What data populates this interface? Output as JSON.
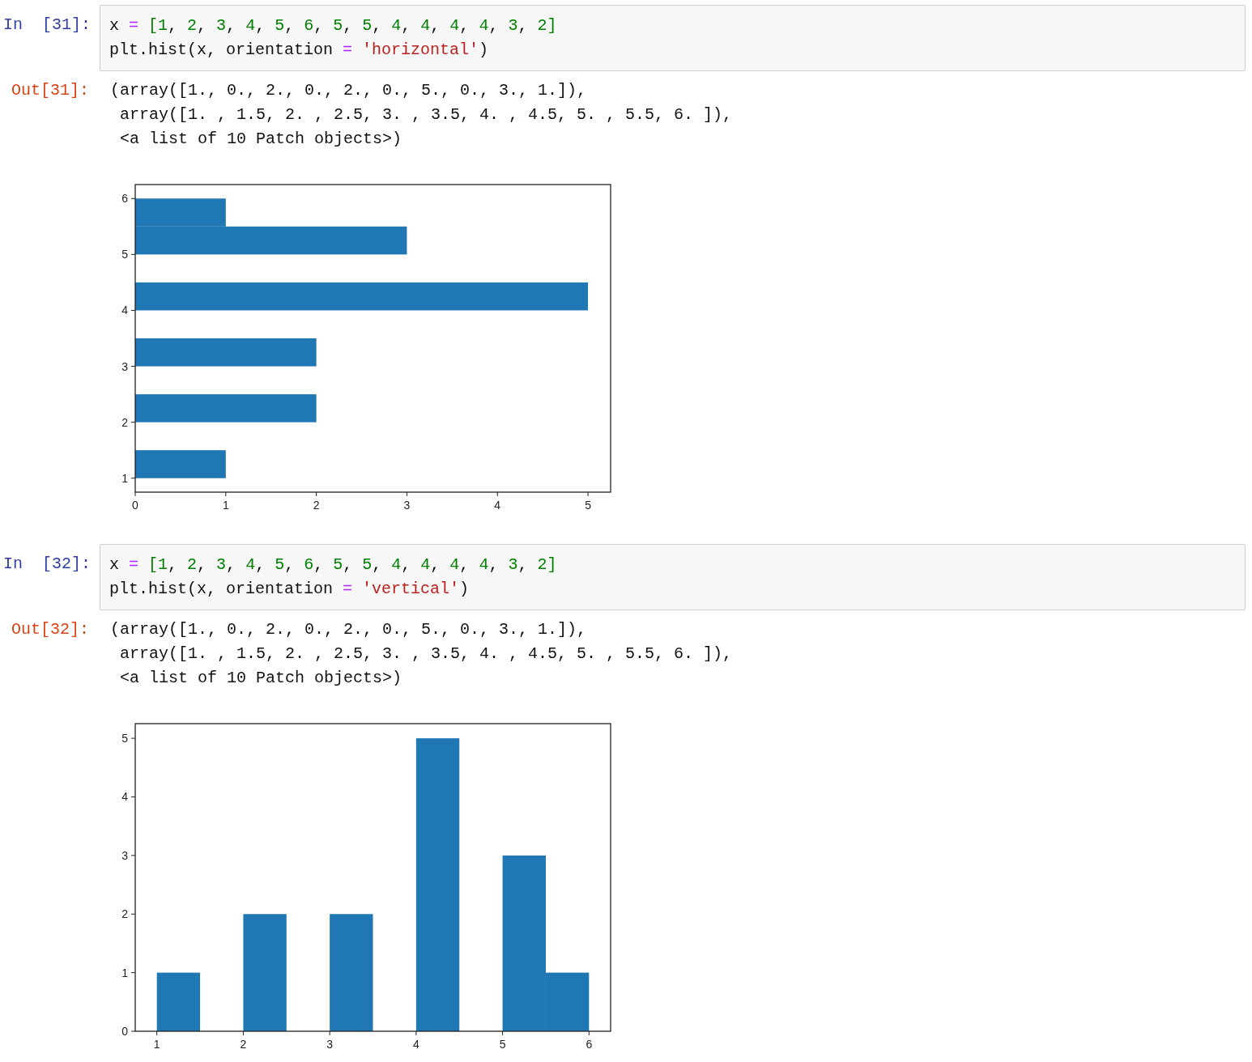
{
  "cells": [
    {
      "in_prompt": "In  [31]:",
      "code_lines": [
        [
          {
            "text": "x ",
            "kind": "plain"
          },
          {
            "text": "=",
            "kind": "op"
          },
          {
            "text": " [1",
            "kind": "num"
          },
          {
            "text": ", ",
            "kind": "plain"
          },
          {
            "text": "2",
            "kind": "num"
          },
          {
            "text": ", ",
            "kind": "plain"
          },
          {
            "text": "3",
            "kind": "num"
          },
          {
            "text": ", ",
            "kind": "plain"
          },
          {
            "text": "4",
            "kind": "num"
          },
          {
            "text": ", ",
            "kind": "plain"
          },
          {
            "text": "5",
            "kind": "num"
          },
          {
            "text": ", ",
            "kind": "plain"
          },
          {
            "text": "6",
            "kind": "num"
          },
          {
            "text": ", ",
            "kind": "plain"
          },
          {
            "text": "5",
            "kind": "num"
          },
          {
            "text": ", ",
            "kind": "plain"
          },
          {
            "text": "5",
            "kind": "num"
          },
          {
            "text": ", ",
            "kind": "plain"
          },
          {
            "text": "4",
            "kind": "num"
          },
          {
            "text": ", ",
            "kind": "plain"
          },
          {
            "text": "4",
            "kind": "num"
          },
          {
            "text": ", ",
            "kind": "plain"
          },
          {
            "text": "4",
            "kind": "num"
          },
          {
            "text": ", ",
            "kind": "plain"
          },
          {
            "text": "4",
            "kind": "num"
          },
          {
            "text": ", ",
            "kind": "plain"
          },
          {
            "text": "3",
            "kind": "num"
          },
          {
            "text": ", ",
            "kind": "plain"
          },
          {
            "text": "2]",
            "kind": "num"
          }
        ],
        [
          {
            "text": "plt.hist(x, orientation ",
            "kind": "plain"
          },
          {
            "text": "=",
            "kind": "op"
          },
          {
            "text": " 'horizontal'",
            "kind": "str"
          },
          {
            "text": ")",
            "kind": "plain"
          }
        ]
      ],
      "out_prompt": "Out[31]:",
      "output_lines": [
        "(array([1., 0., 2., 0., 2., 0., 5., 0., 3., 1.]),",
        " array([1. , 1.5, 2. , 2.5, 3. , 3.5, 4. , 4.5, 5. , 5.5, 6. ]),",
        " <a list of 10 Patch objects>)"
      ],
      "chart_data": {
        "type": "bar",
        "orientation": "horizontal",
        "x": [
          1.25,
          1.75,
          2.25,
          2.75,
          3.25,
          3.75,
          4.25,
          4.75,
          5.25,
          5.75
        ],
        "series": [
          {
            "color": "#1f77b4",
            "values": [
              1,
              0,
              2,
              0,
              2,
              0,
              5,
              0,
              3,
              1
            ]
          }
        ],
        "xlim": [
          0,
          5.25
        ],
        "ylim": [
          0.75,
          6.25
        ],
        "xticks": [
          0,
          1,
          2,
          3,
          4,
          5
        ],
        "yticks": [
          1,
          2,
          3,
          4,
          5,
          6
        ]
      }
    },
    {
      "in_prompt": "In  [32]:",
      "code_lines": [
        [
          {
            "text": "x ",
            "kind": "plain"
          },
          {
            "text": "=",
            "kind": "op"
          },
          {
            "text": " [1",
            "kind": "num"
          },
          {
            "text": ", ",
            "kind": "plain"
          },
          {
            "text": "2",
            "kind": "num"
          },
          {
            "text": ", ",
            "kind": "plain"
          },
          {
            "text": "3",
            "kind": "num"
          },
          {
            "text": ", ",
            "kind": "plain"
          },
          {
            "text": "4",
            "kind": "num"
          },
          {
            "text": ", ",
            "kind": "plain"
          },
          {
            "text": "5",
            "kind": "num"
          },
          {
            "text": ", ",
            "kind": "plain"
          },
          {
            "text": "6",
            "kind": "num"
          },
          {
            "text": ", ",
            "kind": "plain"
          },
          {
            "text": "5",
            "kind": "num"
          },
          {
            "text": ", ",
            "kind": "plain"
          },
          {
            "text": "5",
            "kind": "num"
          },
          {
            "text": ", ",
            "kind": "plain"
          },
          {
            "text": "4",
            "kind": "num"
          },
          {
            "text": ", ",
            "kind": "plain"
          },
          {
            "text": "4",
            "kind": "num"
          },
          {
            "text": ", ",
            "kind": "plain"
          },
          {
            "text": "4",
            "kind": "num"
          },
          {
            "text": ", ",
            "kind": "plain"
          },
          {
            "text": "4",
            "kind": "num"
          },
          {
            "text": ", ",
            "kind": "plain"
          },
          {
            "text": "3",
            "kind": "num"
          },
          {
            "text": ", ",
            "kind": "plain"
          },
          {
            "text": "2]",
            "kind": "num"
          }
        ],
        [
          {
            "text": "plt.hist(x, orientation ",
            "kind": "plain"
          },
          {
            "text": "=",
            "kind": "op"
          },
          {
            "text": " 'vertical'",
            "kind": "str"
          },
          {
            "text": ")",
            "kind": "plain"
          }
        ]
      ],
      "out_prompt": "Out[32]:",
      "output_lines": [
        "(array([1., 0., 2., 0., 2., 0., 5., 0., 3., 1.]),",
        " array([1. , 1.5, 2. , 2.5, 3. , 3.5, 4. , 4.5, 5. , 5.5, 6. ]),",
        " <a list of 10 Patch objects>)"
      ],
      "chart_data": {
        "type": "bar",
        "orientation": "vertical",
        "x": [
          1.25,
          1.75,
          2.25,
          2.75,
          3.25,
          3.75,
          4.25,
          4.75,
          5.25,
          5.75
        ],
        "series": [
          {
            "color": "#1f77b4",
            "values": [
              1,
              0,
              2,
              0,
              2,
              0,
              5,
              0,
              3,
              1
            ]
          }
        ],
        "xlim": [
          0.75,
          6.25
        ],
        "ylim": [
          0,
          5.25
        ],
        "xticks": [
          1,
          2,
          3,
          4,
          5,
          6
        ],
        "yticks": [
          0,
          1,
          2,
          3,
          4,
          5
        ]
      }
    }
  ]
}
